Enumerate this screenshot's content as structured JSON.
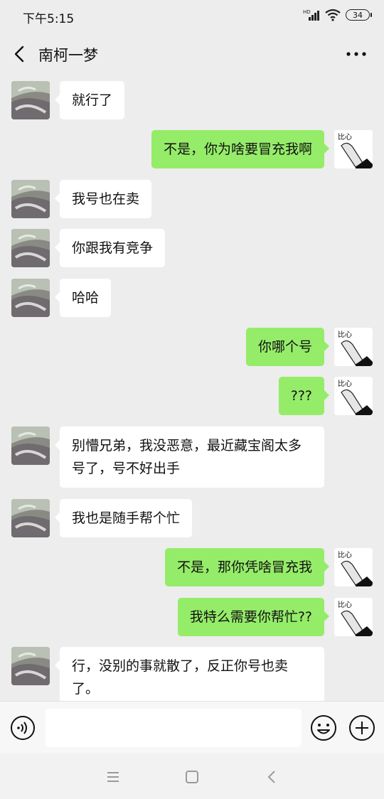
{
  "status": {
    "time": "下午5:15",
    "battery": "34"
  },
  "header": {
    "title": "南柯一梦"
  },
  "messages": [
    {
      "side": "left",
      "text": "就行了"
    },
    {
      "side": "right",
      "text": "不是，你为啥要冒充我啊"
    },
    {
      "side": "left",
      "text": "我号也在卖"
    },
    {
      "side": "left",
      "text": "你跟我有竞争"
    },
    {
      "side": "left",
      "text": "哈哈"
    },
    {
      "side": "right",
      "text": "你哪个号"
    },
    {
      "side": "right",
      "text": "???"
    },
    {
      "side": "left",
      "text": "别懵兄弟，我没恶意，最近藏宝阁太多号了，号不好出手"
    },
    {
      "side": "left",
      "text": "我也是随手帮个忙"
    },
    {
      "side": "right",
      "text": "不是，那你凭啥冒充我"
    },
    {
      "side": "right",
      "text": "我特么需要你帮忙??"
    },
    {
      "side": "left",
      "text": "行，没别的事就散了，反正你号也卖了。"
    }
  ],
  "self_avatar": {
    "text": "比心"
  },
  "input": {
    "placeholder": ""
  },
  "colors": {
    "self_bubble": "#95ec69",
    "other_bubble": "#ffffff",
    "background": "#ededed"
  },
  "icons": {
    "back": "chevron-left-icon",
    "more": "more-dots-icon",
    "voice": "voice-icon",
    "emoji": "smile-icon",
    "plus": "plus-icon",
    "nav_menu": "menu-icon",
    "nav_home": "home-square-icon",
    "nav_back": "nav-back-icon"
  }
}
